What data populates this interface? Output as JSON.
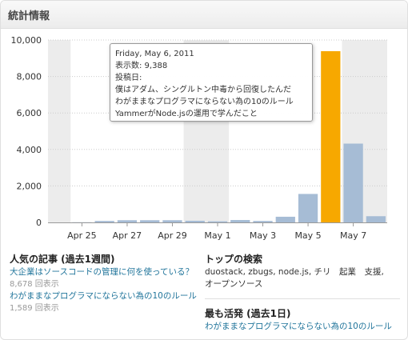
{
  "panel": {
    "title": "統計情報"
  },
  "chart_data": {
    "type": "bar",
    "y_ticks": [
      "0",
      "2,000",
      "4,000",
      "6,000",
      "8,000",
      "10,000"
    ],
    "ylim": [
      0,
      10000
    ],
    "x_labels": [
      "Apr 25",
      "Apr 27",
      "Apr 29",
      "May 1",
      "May 3",
      "May 5",
      "May 7"
    ],
    "categories": [
      "Apr 24",
      "Apr 25",
      "Apr 26",
      "Apr 27",
      "Apr 28",
      "Apr 29",
      "Apr 30",
      "May 1",
      "May 2",
      "May 3",
      "May 4",
      "May 5",
      "May 6",
      "May 7",
      "May 8"
    ],
    "values": [
      0,
      10,
      80,
      120,
      120,
      120,
      90,
      60,
      130,
      80,
      310,
      1560,
      9388,
      4320,
      340
    ],
    "weekend_bands": [
      [
        "Apr 24"
      ],
      [
        "Apr 30",
        "May 1"
      ],
      [
        "May 7",
        "May 8"
      ]
    ],
    "highlight_index": 12,
    "colors": {
      "bar": "#a6bcd5",
      "highlight": "#f7a800",
      "band": "#ececec",
      "grid": "#cccccc"
    }
  },
  "tooltip": {
    "date": "Friday, May 6, 2011",
    "views": "表示数: 9,388",
    "posts_label": "投稿日:",
    "posts": [
      "僕はアダム、シングルトン中毒から回復したんだ",
      "わがままなプログラマにならない為の10のルール",
      "YammerがNode.jsの運用で学んだこと"
    ]
  },
  "popular": {
    "title": "人気の記事 (過去1週間)",
    "items": [
      {
        "title": "大企業はソースコードの管理に何を使っている？",
        "views": "8,678 回表示"
      },
      {
        "title": "わがままなプログラマにならない為の10のルール",
        "views": "1,589 回表示"
      }
    ]
  },
  "search": {
    "title": "トップの検索",
    "terms": "duostack, zbugs, node.js, チリ　起業　支援, オープンソース"
  },
  "active": {
    "title": "最も活発 (過去1日)",
    "items": [
      {
        "title": "わがままなプログラマにならない為の10のルール"
      }
    ]
  }
}
